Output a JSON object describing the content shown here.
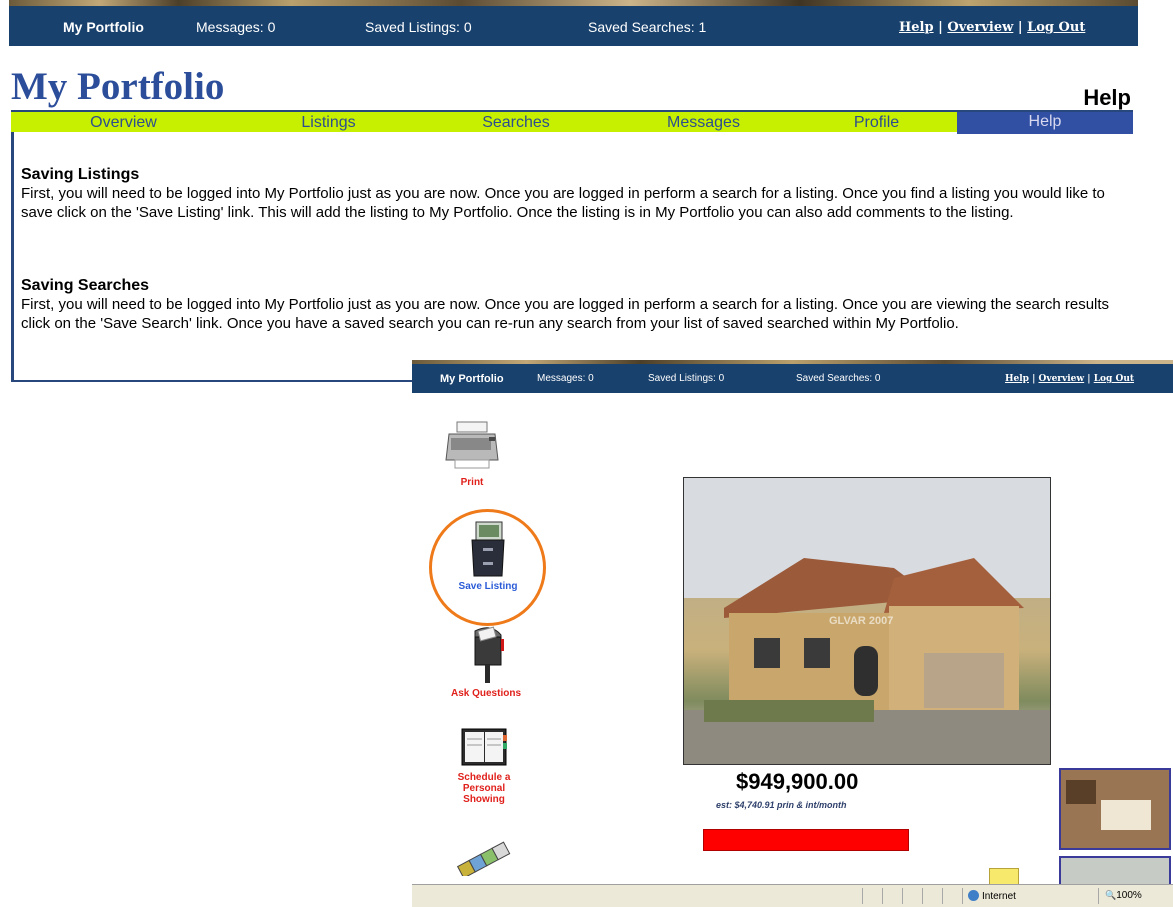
{
  "top_bar": {
    "brand": "My Portfolio",
    "messages": "Messages: 0",
    "saved_listings": "Saved Listings: 0",
    "saved_searches": "Saved Searches: 1",
    "links": {
      "help": "Help",
      "sep1": " | ",
      "overview": "Overview",
      "sep2": " | ",
      "logout": "Log Out"
    }
  },
  "page": {
    "title": "My Portfolio",
    "section_heading": "Help"
  },
  "tabs": [
    {
      "label": "Overview",
      "active": false
    },
    {
      "label": "Listings",
      "active": false
    },
    {
      "label": "Searches",
      "active": false
    },
    {
      "label": "Messages",
      "active": false
    },
    {
      "label": "Profile",
      "active": false
    },
    {
      "label": "Help",
      "active": true
    }
  ],
  "sections": [
    {
      "title": "Saving Listings",
      "body": "First, you will need to be logged into My Portfolio just as you are now. Once you are logged in perform a search for a listing. Once you find a listing you would like to save click on the 'Save Listing' link. This will add the listing to My Portfolio. Once the listing is in My Portfolio you can also add comments to the listing."
    },
    {
      "title": "Saving Searches",
      "body": "First, you will need to be logged into My Portfolio just as you are now. Once you are logged in perform a search for a listing. Once you are viewing the search results click on the 'Save Search' link. Once you have a saved search you can re-run any search from your list of saved searched within My Portfolio."
    }
  ],
  "overlay": {
    "top_bar": {
      "brand": "My Portfolio",
      "messages": "Messages: 0",
      "saved_listings": "Saved Listings: 0",
      "saved_searches": "Saved Searches: 0",
      "links": {
        "help": "Help",
        "sep1": " | ",
        "overview": "Overview",
        "sep2": " | ",
        "logout": "Log Out"
      }
    },
    "actions": {
      "print": "Print",
      "save_listing": "Save Listing",
      "ask_questions": "Ask Questions",
      "schedule_1": "Schedule a",
      "schedule_2": "Personal",
      "schedule_3": "Showing"
    },
    "listing": {
      "watermark": "GLVAR 2007",
      "price": "$949,900.00",
      "estimate": "est: $4,740.91 prin & int/month"
    },
    "status_bar": {
      "zone": "Internet",
      "zoom": "100%"
    },
    "colors": {
      "header": "#18416d",
      "action_red": "#e0211c",
      "save_blue": "#2a5bd7",
      "highlight_circle": "#ef7a1a"
    }
  }
}
